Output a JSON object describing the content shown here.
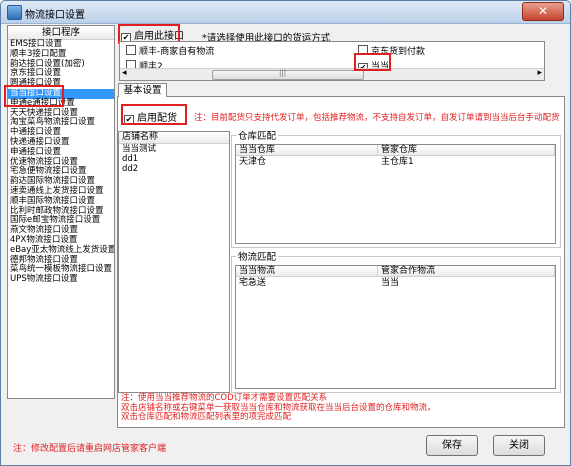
{
  "window": {
    "title": "物流接口设置",
    "close_glyph": "✕"
  },
  "left_list": {
    "header": "接口程序",
    "items": [
      "EMS接口设置",
      "顺丰3接口配置",
      "韵达接口设置(加密)",
      "京东接口设置",
      "圆通接口设置",
      "当当接口设置",
      "申通e通接口设置",
      "天天快递接口设置",
      "淘宝菜鸟物流接口设置",
      "中通接口设置",
      "快递通接口设置",
      "申通接口设置",
      "优速物流接口设置",
      "宅急便物流接口设置",
      "韵达国际物流接口设置",
      "速卖通线上发货接口设置",
      "顺丰国际物流接口设置",
      "比利时邮政物流接口设置",
      "国际e邮宝物流接口设置",
      "燕文物流接口设置",
      "4PX物流接口设置",
      "eBay亚太物流线上发货设置",
      "德邦物流接口设置",
      "菜鸟统一模板物流接口设置",
      "UPS物流接口设置"
    ],
    "selected": "当当接口设置"
  },
  "top": {
    "enable_label": "启用此接口",
    "note": "*请选择使用此接口的货运方式"
  },
  "express": {
    "col1": [
      {
        "label": "顺丰-商家自有物流",
        "checked": false
      },
      {
        "label": "顺丰2",
        "checked": false
      }
    ],
    "col2": [
      {
        "label": "京东货到付款",
        "checked": false
      },
      {
        "label": "当当",
        "checked": true
      }
    ],
    "scroll_left": "◂",
    "scroll_right": "▸",
    "grip": "|||"
  },
  "tab": {
    "label": "基本设置"
  },
  "distribution": {
    "enable_label": "启用配货",
    "note": "注：目前配货只支持代发订单，包括推荐物流，不支持自发订单，自发订单请到当当后台手动配货"
  },
  "stores": {
    "header": "店铺名称",
    "rows": [
      "当当测试",
      "dd1",
      "dd2"
    ]
  },
  "warehouse": {
    "legend": "仓库匹配",
    "headers": [
      "当当仓库",
      "管家仓库"
    ],
    "rows": [
      [
        "天津仓",
        "主仓库1"
      ]
    ]
  },
  "logistics": {
    "legend": "物流匹配",
    "headers": [
      "当当物流",
      "管家合作物流"
    ],
    "rows": [
      [
        "宅急送",
        "当当"
      ]
    ]
  },
  "bottom_note": [
    "注：使用当当推荐物流的COD订单才需要设置匹配关系",
    "双击店铺名称或右键菜单一获取当当仓库和物流获取在当当后台设置的仓库和物流，",
    "双击仓库匹配和物流匹配列表里的项完成匹配"
  ],
  "footer_note": "注：修改配置后请重启网店管家客户端",
  "buttons": {
    "save": "保存",
    "close": "关闭"
  },
  "colors": {
    "highlight_red": "#e02020",
    "selection_blue": "#3399ff"
  }
}
